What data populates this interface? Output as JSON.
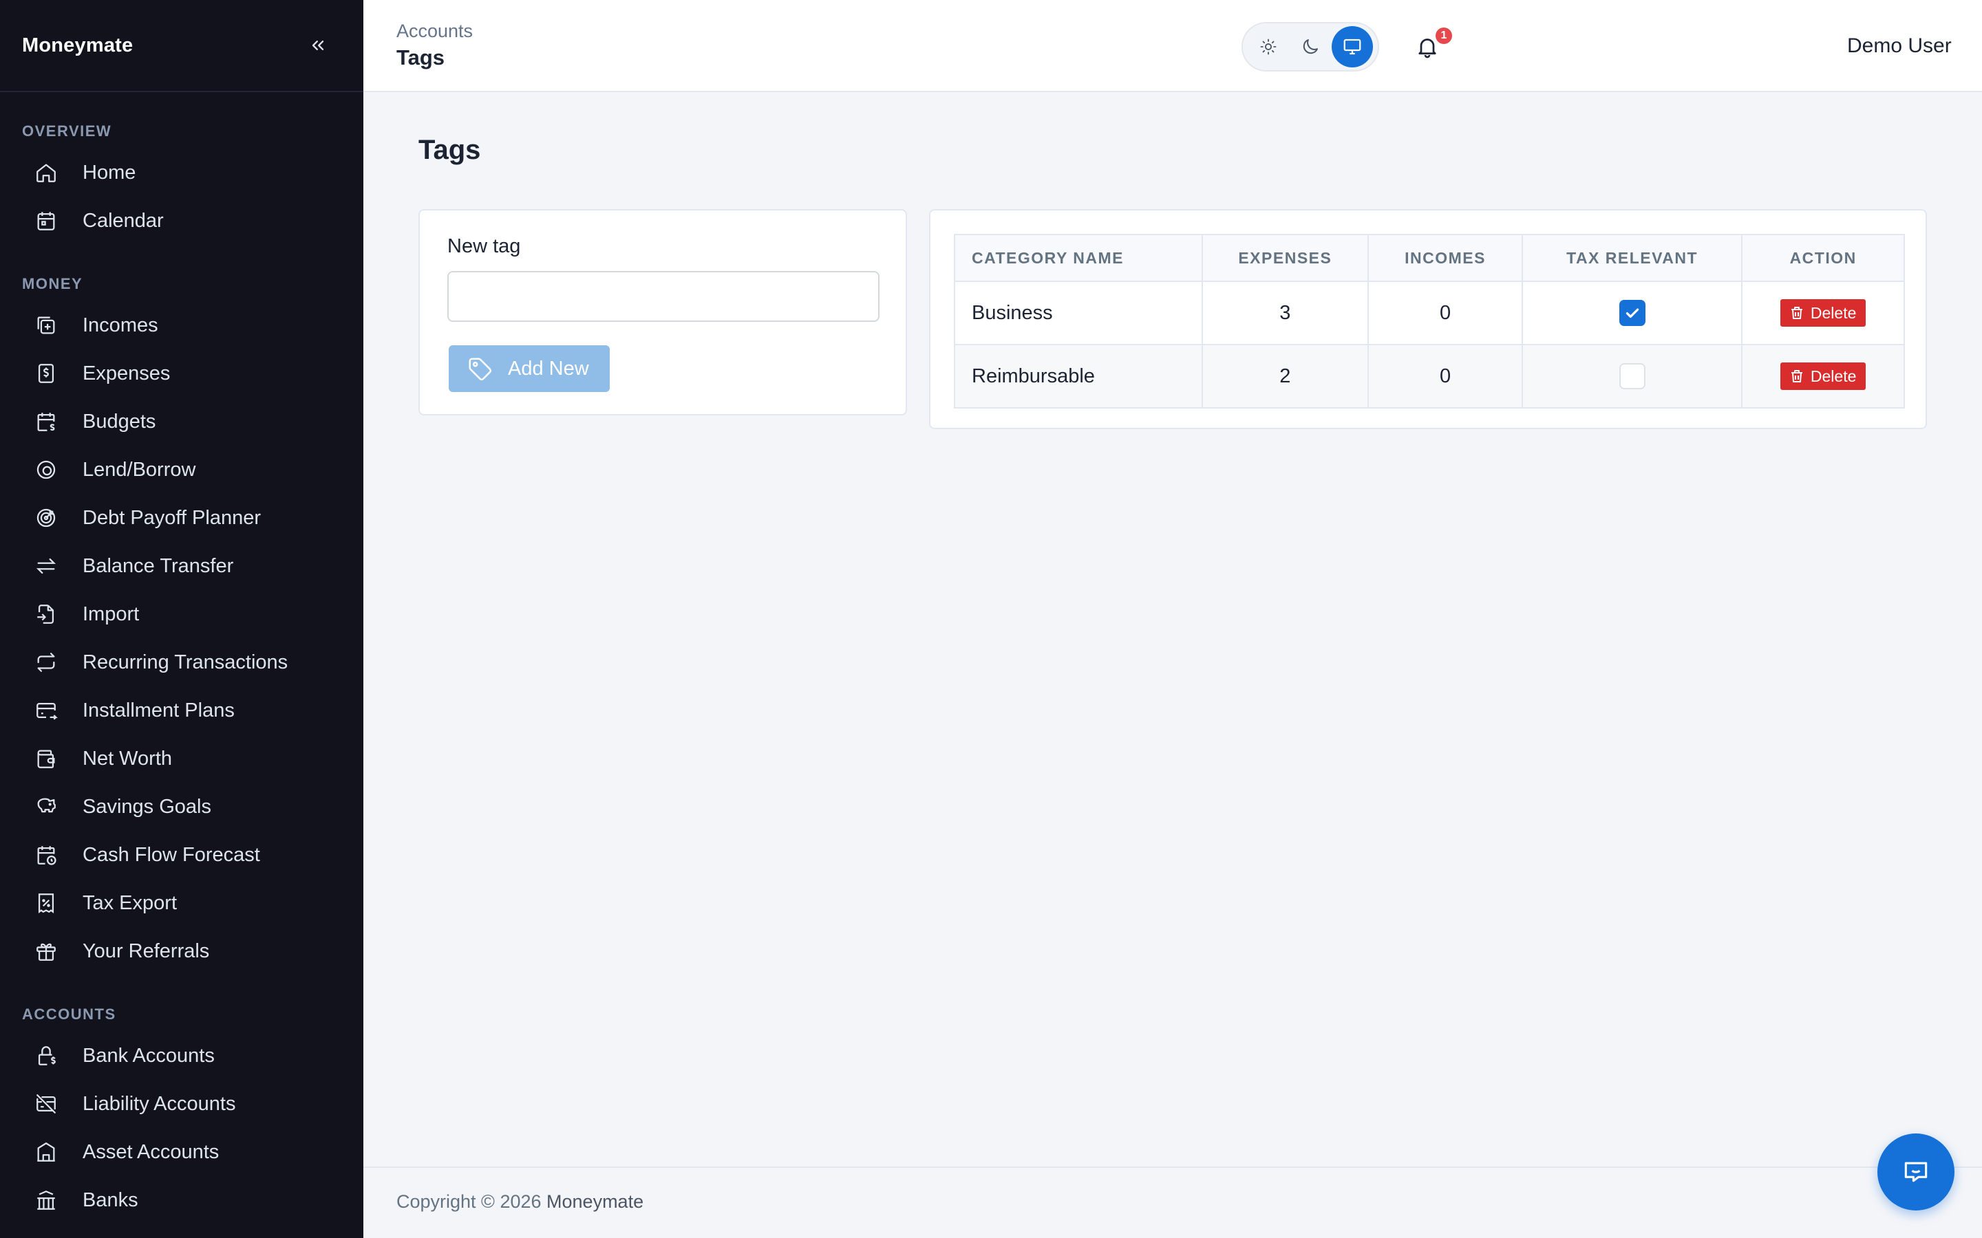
{
  "app": {
    "name": "Moneymate"
  },
  "sidebar": {
    "sections": [
      {
        "label": "OVERVIEW",
        "items": [
          {
            "label": "Home",
            "icon": "home-icon"
          },
          {
            "label": "Calendar",
            "icon": "calendar-icon"
          }
        ]
      },
      {
        "label": "MONEY",
        "items": [
          {
            "label": "Incomes",
            "icon": "incomes-icon"
          },
          {
            "label": "Expenses",
            "icon": "expenses-icon"
          },
          {
            "label": "Budgets",
            "icon": "budgets-icon"
          },
          {
            "label": "Lend/Borrow",
            "icon": "lend-borrow-icon"
          },
          {
            "label": "Debt Payoff Planner",
            "icon": "target-icon"
          },
          {
            "label": "Balance Transfer",
            "icon": "transfer-icon"
          },
          {
            "label": "Import",
            "icon": "import-icon"
          },
          {
            "label": "Recurring Transactions",
            "icon": "repeat-icon"
          },
          {
            "label": "Installment Plans",
            "icon": "credit-card-icon"
          },
          {
            "label": "Net Worth",
            "icon": "wallet-icon"
          },
          {
            "label": "Savings Goals",
            "icon": "piggy-bank-icon"
          },
          {
            "label": "Cash Flow Forecast",
            "icon": "calendar-clock-icon"
          },
          {
            "label": "Tax Export",
            "icon": "receipt-icon"
          },
          {
            "label": "Your Referrals",
            "icon": "gift-icon"
          }
        ]
      },
      {
        "label": "ACCOUNTS",
        "items": [
          {
            "label": "Bank Accounts",
            "icon": "lock-dollar-icon"
          },
          {
            "label": "Liability Accounts",
            "icon": "card-off-icon"
          },
          {
            "label": "Asset Accounts",
            "icon": "building-icon"
          },
          {
            "label": "Banks",
            "icon": "bank-icon"
          }
        ]
      }
    ]
  },
  "header": {
    "breadcrumb": "Accounts",
    "title": "Tags",
    "notifications_count": "1",
    "user_name": "Demo User"
  },
  "main": {
    "page_title": "Tags",
    "new_tag": {
      "label": "New tag",
      "value": "",
      "button_label": "Add New"
    },
    "table": {
      "columns": [
        "CATEGORY NAME",
        "EXPENSES",
        "INCOMES",
        "TAX RELEVANT",
        "ACTION"
      ],
      "rows": [
        {
          "name": "Business",
          "expenses": "3",
          "incomes": "0",
          "tax_relevant": true,
          "action": "Delete"
        },
        {
          "name": "Reimbursable",
          "expenses": "2",
          "incomes": "0",
          "tax_relevant": false,
          "action": "Delete"
        }
      ]
    }
  },
  "footer": {
    "copyright": "Copyright © 2026",
    "brand": "Moneymate"
  },
  "colors": {
    "sidebar_bg": "#12121c",
    "primary": "#1570d8",
    "danger": "#d92d2d",
    "add_button": "#8fbde8"
  }
}
